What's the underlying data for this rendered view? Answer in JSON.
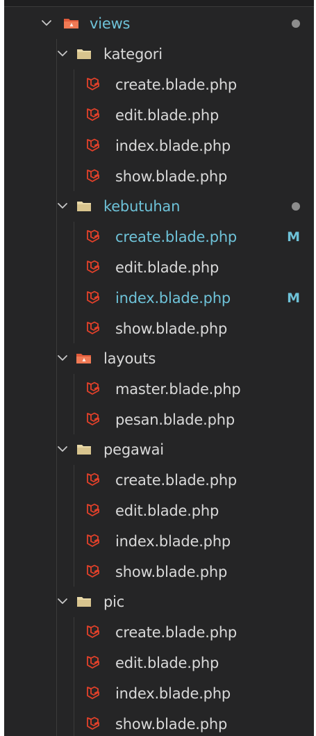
{
  "tree": {
    "views": {
      "label": "views",
      "status": "modified-dot"
    },
    "kategori": {
      "label": "kategori",
      "files": [
        "create.blade.php",
        "edit.blade.php",
        "index.blade.php",
        "show.blade.php"
      ]
    },
    "kebutuhan": {
      "label": "kebutuhan",
      "status": "modified-dot",
      "files": [
        "create.blade.php",
        "edit.blade.php",
        "index.blade.php",
        "show.blade.php"
      ],
      "badges": {
        "create": "M",
        "index": "M"
      }
    },
    "layouts": {
      "label": "layouts",
      "files": [
        "master.blade.php",
        "pesan.blade.php"
      ]
    },
    "pegawai": {
      "label": "pegawai",
      "files": [
        "create.blade.php",
        "edit.blade.php",
        "index.blade.php",
        "show.blade.php"
      ]
    },
    "pic": {
      "label": "pic",
      "files": [
        "create.blade.php",
        "edit.blade.php",
        "index.blade.php",
        "show.blade.php"
      ]
    }
  },
  "colors": {
    "background": "#252526",
    "text": "#d9d9d9",
    "modified_text": "#6ec2d8",
    "folder_icon": "#e8d8a8",
    "blade_icon": "#e3412a",
    "special_folder_icon": "#e05a3a",
    "status_dot": "#8d8d8d"
  },
  "icons": {
    "chevron": "chevron-down-icon",
    "folder": "folder-icon",
    "special_folder": "views-folder-icon",
    "file": "laravel-blade-icon"
  }
}
